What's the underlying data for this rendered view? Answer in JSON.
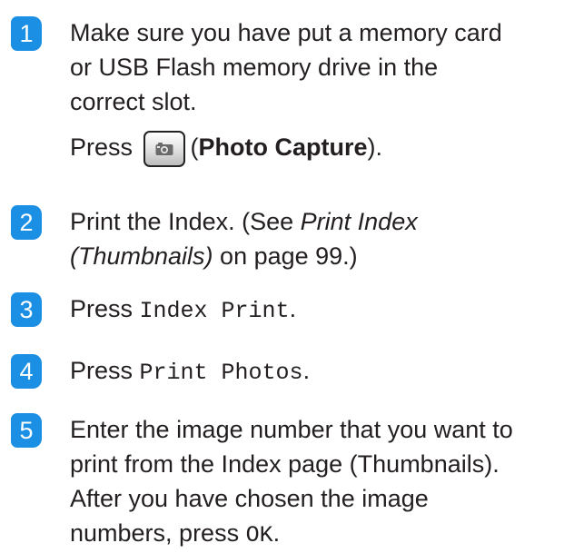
{
  "colors": {
    "badge": "#1a8fe3",
    "text": "#231f20"
  },
  "steps": [
    {
      "number": "1",
      "lines": [
        "Make sure you have put a memory card",
        "or USB Flash memory drive in the",
        "correct slot."
      ],
      "press_prefix": "Press",
      "button_icon": "camera-icon",
      "press_paren_open": "(",
      "press_bold": "Photo Capture",
      "press_paren_close": ")."
    },
    {
      "number": "2",
      "line1_pre": "Print the Index. (See ",
      "line1_ital": "Print Index",
      "line2_ital": "(Thumbnails)",
      "line2_post": " on page 99.)"
    },
    {
      "number": "3",
      "pre": "Press ",
      "mono": "Index Print",
      "post": "."
    },
    {
      "number": "4",
      "pre": "Press ",
      "mono": "Print Photos",
      "post": "."
    },
    {
      "number": "5",
      "lines": [
        "Enter the image number that you want to",
        "print from the Index page (Thumbnails).",
        "After you have chosen the image"
      ],
      "last_pre": "numbers, press ",
      "last_mono": "OK",
      "last_post": "."
    }
  ]
}
